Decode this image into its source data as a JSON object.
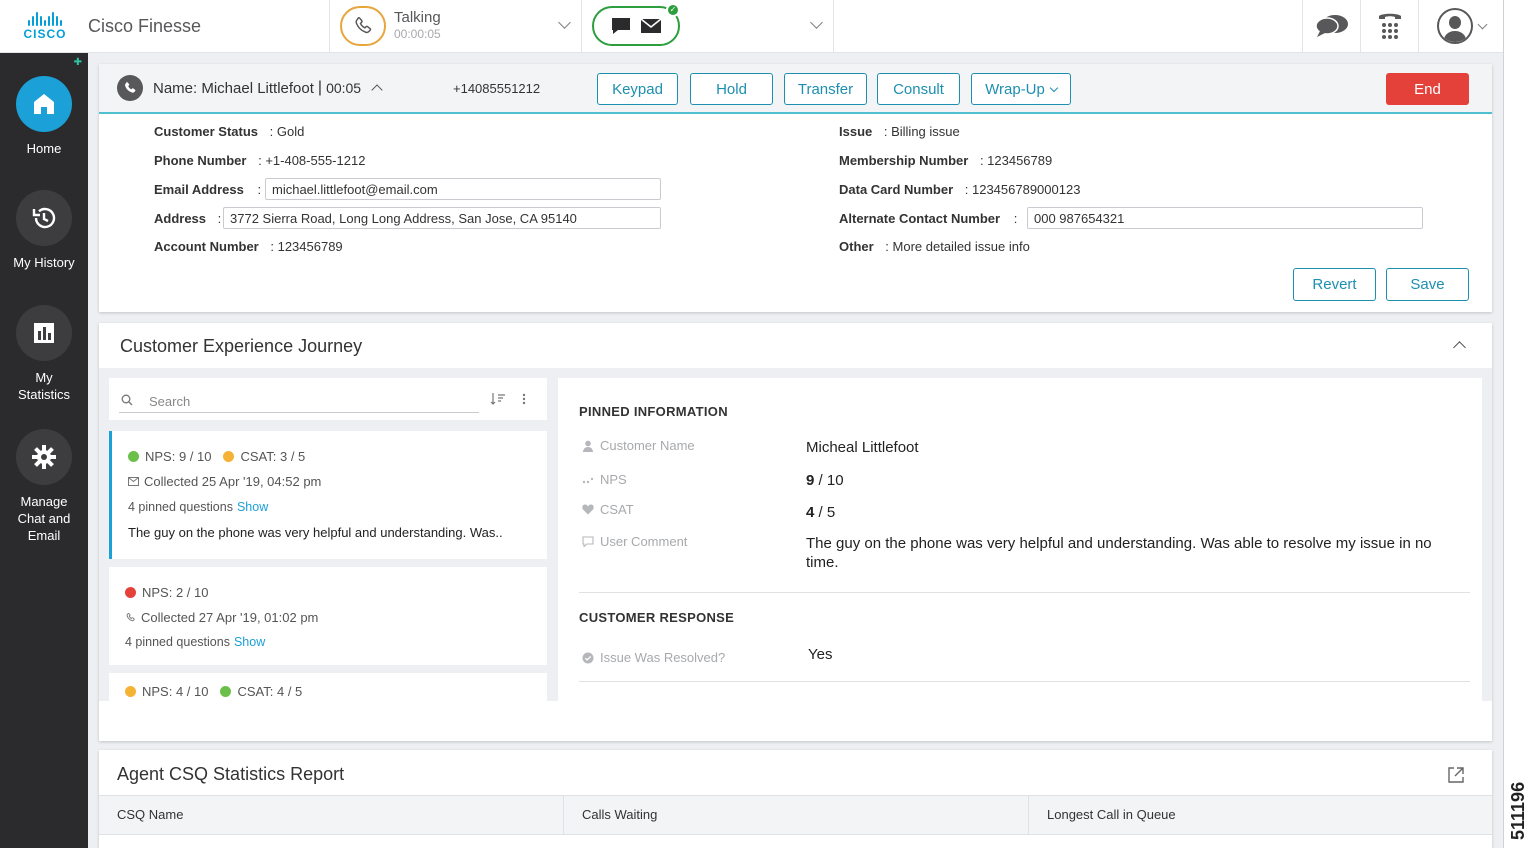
{
  "header": {
    "brand": "Cisco Finesse",
    "logo_word": "CISCO",
    "agent_state": {
      "label": "Talking",
      "timer": "00:00:05",
      "color": "#e8a53a"
    },
    "media_status_color": "#2c9e3e"
  },
  "nav": {
    "items": [
      {
        "label": "Home",
        "icon": "home-icon",
        "active": true
      },
      {
        "label": "My History",
        "icon": "history-icon"
      },
      {
        "label_line1": "My",
        "label_line2": "Statistics",
        "icon": "bar-chart-icon"
      },
      {
        "label_line1": "Manage",
        "label_line2": "Chat and",
        "label_line3": "Email",
        "icon": "gear-icon"
      }
    ]
  },
  "call": {
    "name_line": "Name: Michael Littlefoot",
    "separator": "|",
    "timer": "00:05",
    "number": "+14085551212",
    "buttons": {
      "keypad": "Keypad",
      "hold": "Hold",
      "transfer": "Transfer",
      "consult": "Consult",
      "wrapup": "Wrap-Up",
      "end": "End"
    },
    "fields_left": [
      {
        "label": "Customer Status",
        "value": ": Gold"
      },
      {
        "label": "Phone Number",
        "value": ": +1-408-555-1212"
      },
      {
        "label": "Email Address",
        "sep": ":",
        "input": "michael.littlefoot@email.com"
      },
      {
        "label": "Address",
        "sep": ":",
        "input": "3772 Sierra Road, Long Long Address, San Jose, CA 95140"
      },
      {
        "label": "Account Number",
        "value": ": 123456789"
      }
    ],
    "fields_right": [
      {
        "label": "Issue",
        "value": ": Billing issue"
      },
      {
        "label": "Membership Number",
        "value": ": 123456789"
      },
      {
        "label": "Data Card Number",
        "value": ": 123456789000123"
      },
      {
        "label": "Alternate Contact Number",
        "sep": ":",
        "input": "000 987654321"
      },
      {
        "label": "Other",
        "value": ": More detailed issue info"
      }
    ],
    "revert": "Revert",
    "save": "Save",
    "accent": "#1d8fb0",
    "end_color": "#e5413b"
  },
  "journey": {
    "title": "Customer Experience Journey",
    "search_placeholder": "Search",
    "cards": [
      {
        "nps": "NPS: 9 / 10",
        "csat": "CSAT: 3 / 5",
        "collected": "Collected 25 Apr '19, 04:52 pm",
        "pinned": "4 pinned questions",
        "show": "Show",
        "comment": "The guy on the phone was very helpful and understanding. Was.."
      },
      {
        "nps": "NPS: 2 / 10",
        "collected": "Collected 27 Apr '19, 01:02 pm",
        "pinned": "4 pinned questions",
        "show": "Show"
      },
      {
        "nps": "NPS: 4 / 10",
        "csat": "CSAT: 4 / 5"
      }
    ],
    "pinned_title": "PINNED INFORMATION",
    "pinned": {
      "customer_name_label": "Customer Name",
      "customer_name": "Micheal Littlefoot",
      "nps_label": "NPS",
      "nps_score": "9",
      "nps_scale": " / 10",
      "csat_label": "CSAT",
      "csat_score": "4",
      "csat_scale": " / 5",
      "comment_label": "User Comment",
      "comment": "The guy on the phone was very helpful and understanding. Was able to resolve my issue in no time."
    },
    "response_title": "CUSTOMER RESPONSE",
    "response": {
      "label": "Issue Was Resolved?",
      "value": "Yes"
    }
  },
  "csq": {
    "title": "Agent CSQ Statistics Report",
    "columns": [
      "CSQ Name",
      "Calls Waiting",
      "Longest Call in Queue"
    ]
  },
  "figure_number": "511196"
}
